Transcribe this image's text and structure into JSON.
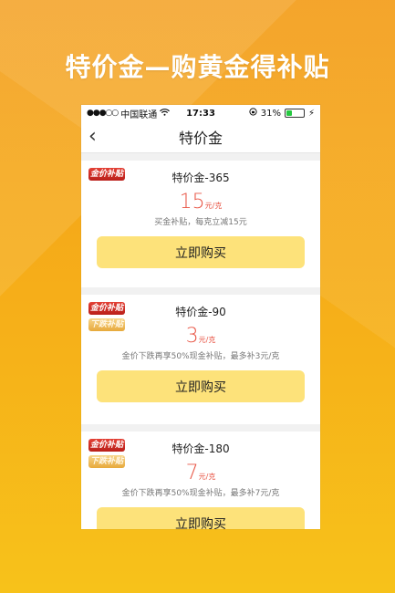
{
  "banner": {
    "title": "特价金—购黄金得补贴"
  },
  "status_bar": {
    "signal": "●●●○○",
    "carrier": "中国联通",
    "wifi_icon": "wifi-icon",
    "time": "17:33",
    "battery_pct": "31%"
  },
  "nav": {
    "title": "特价金"
  },
  "cards": [
    {
      "tags": [
        "金价补贴"
      ],
      "title": "特价金-365",
      "price": "15",
      "unit": "元/克",
      "desc": "买金补贴，每克立减15元",
      "button": "立即购买"
    },
    {
      "tags": [
        "金价补贴",
        "下跌补贴"
      ],
      "title": "特价金-90",
      "price": "3",
      "unit": "元/克",
      "desc": "金价下跌再享50%现金补贴，最多补3元/克",
      "button": "立即购买"
    },
    {
      "tags": [
        "金价补贴",
        "下跌补贴"
      ],
      "title": "特价金-180",
      "price": "7",
      "unit": "元/克",
      "desc": "金价下跌再享50%现金补贴，最多补7元/克",
      "button": "立即购买"
    }
  ],
  "colors": {
    "accent": "#e85545",
    "button_bg": "#fde27a",
    "background": "#f7b21c"
  }
}
